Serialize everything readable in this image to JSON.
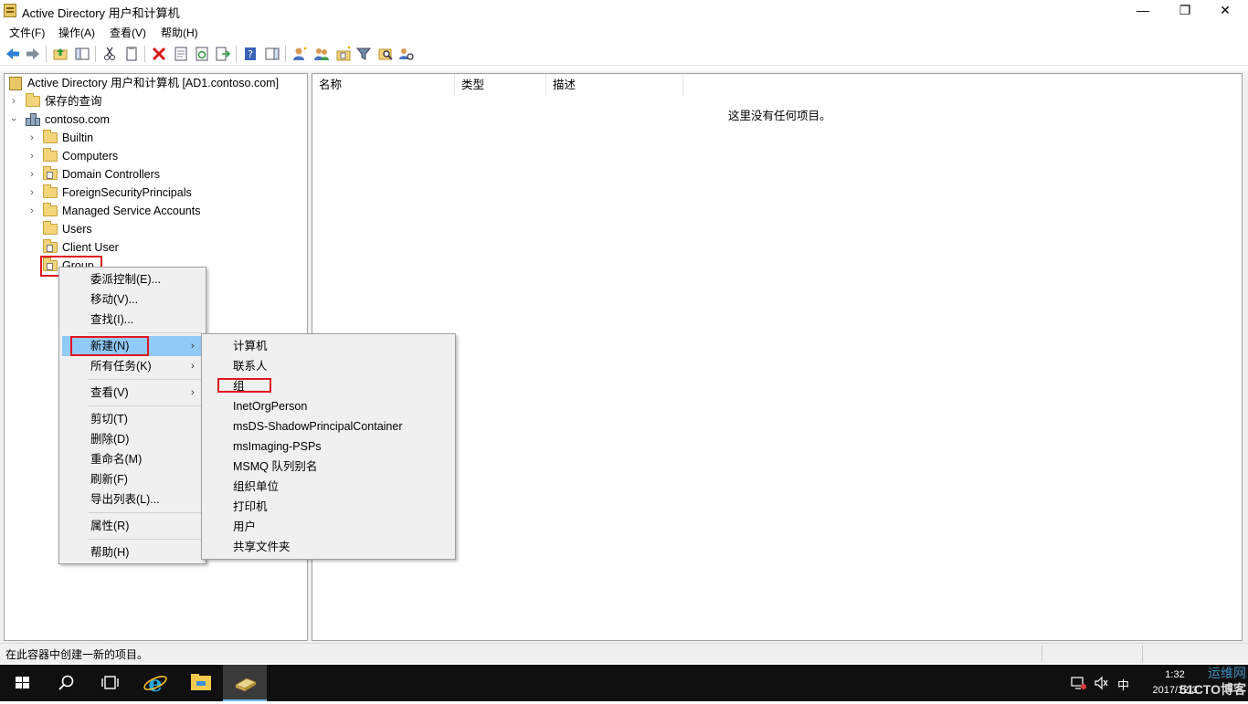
{
  "window": {
    "title": "Active Directory 用户和计算机",
    "minimize_glyph": "—",
    "restore_glyph": "❐",
    "close_glyph": "✕"
  },
  "menubar": [
    "文件(F)",
    "操作(A)",
    "查看(V)",
    "帮助(H)"
  ],
  "toolbar_icons": [
    "back-arrow-icon",
    "forward-arrow-icon",
    "up-folder-icon",
    "show-console-tree-icon",
    "cut-icon",
    "copy-icon",
    "delete-icon",
    "properties-icon",
    "refresh-icon",
    "export-list-icon",
    "help-icon",
    "show-action-pane-icon",
    "new-user-icon",
    "new-group-icon",
    "new-ou-icon",
    "filter-icon",
    "find-icon",
    "add-to-group-icon"
  ],
  "tree": {
    "root": "Active Directory 用户和计算机 [AD1.contoso.com]",
    "saved_queries": "保存的查询",
    "domain": "contoso.com",
    "children": [
      "Builtin",
      "Computers",
      "Domain Controllers",
      "ForeignSecurityPrincipals",
      "Managed Service Accounts",
      "Users",
      "Client User",
      "Group"
    ]
  },
  "list": {
    "columns": [
      "名称",
      "类型",
      "描述"
    ],
    "empty_message": "这里没有任何项目。"
  },
  "context_menu": {
    "items": [
      "委派控制(E)...",
      "移动(V)...",
      "查找(I)...",
      "新建(N)",
      "所有任务(K)",
      "查看(V)",
      "剪切(T)",
      "删除(D)",
      "重命名(M)",
      "刷新(F)",
      "导出列表(L)...",
      "属性(R)",
      "帮助(H)"
    ],
    "highlighted": "新建(N)"
  },
  "submenu_new": {
    "items": [
      "计算机",
      "联系人",
      "组",
      "InetOrgPerson",
      "msDS-ShadowPrincipalContainer",
      "msImaging-PSPs",
      "MSMQ 队列别名",
      "组织单位",
      "打印机",
      "用户",
      "共享文件夹"
    ],
    "boxed": "组"
  },
  "statusbar": {
    "text": "在此容器中创建一新的项目。"
  },
  "taskbar": {
    "ime": "中",
    "clock_time": "1:32",
    "clock_date": "2017/12/3",
    "watermark_top": "运维网",
    "watermark_bottom": "51CTO博客"
  },
  "colors": {
    "highlight": "#91c9f7",
    "red_box": "#e0151e",
    "taskbar": "#101010"
  }
}
